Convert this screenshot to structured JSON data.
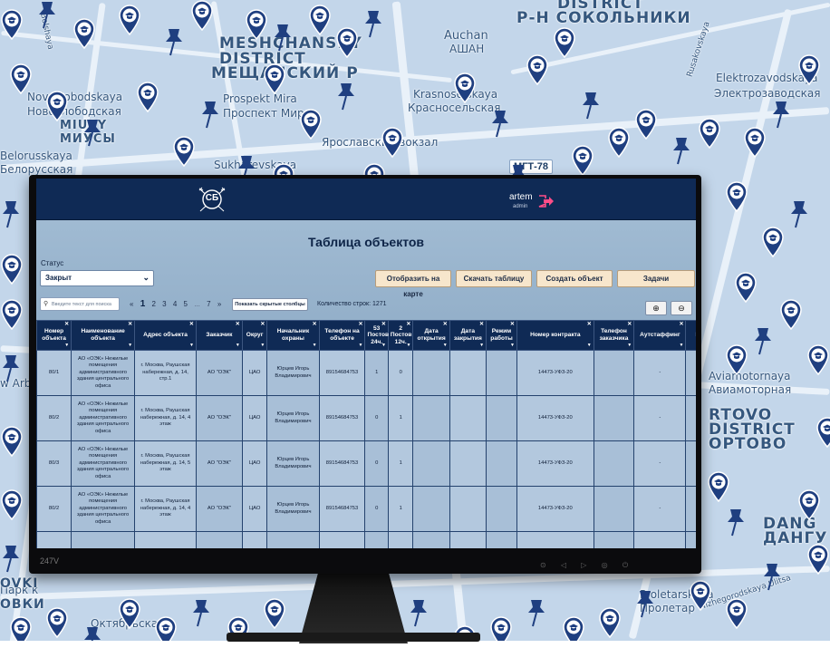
{
  "map": {
    "labels": [
      {
        "text": "DISTRICT",
        "big": true
      },
      {
        "text": "Р-Н СОКОЛЬНИКИ",
        "big": true
      },
      {
        "text": "MESHCHANSKY",
        "big": true
      },
      {
        "text": "DISTRICT",
        "big": true
      },
      {
        "text": "МЕЩАНСКИЙ Р",
        "big": true
      },
      {
        "text": "Auchan"
      },
      {
        "text": "АШАН"
      },
      {
        "text": "Novoslobodskaya"
      },
      {
        "text": "Новослободская"
      },
      {
        "text": "MIUSY",
        "big": true
      },
      {
        "text": "МИУСЫ",
        "big": true
      },
      {
        "text": "Prospekt Mira"
      },
      {
        "text": "Проспект Мира"
      },
      {
        "text": "Krasnoselskaya"
      },
      {
        "text": "Красносельская"
      },
      {
        "text": "Elektrozavodskaya"
      },
      {
        "text": "Электрозаводская"
      },
      {
        "text": "Ярославский вокзал"
      },
      {
        "text": "Sukharevskaya"
      },
      {
        "text": "Belorusskaya"
      },
      {
        "text": "Белорусская"
      },
      {
        "text": "Aviamotornaya"
      },
      {
        "text": "Авиамоторная"
      },
      {
        "text": "RTOVO",
        "big": true
      },
      {
        "text": "DISTRICT",
        "big": true
      },
      {
        "text": "ОРТОВО",
        "big": true
      },
      {
        "text": "DANG",
        "big": true
      },
      {
        "text": "ДАНГУ",
        "big": true
      },
      {
        "text": "Proletarskaya"
      },
      {
        "text": "Пролетар"
      },
      {
        "text": "Октябрьская"
      },
      {
        "text": "Парк к"
      },
      {
        "text": "OVKI",
        "big": true
      },
      {
        "text": "ОВКИ",
        "big": true
      },
      {
        "text": "w Arbat"
      },
      {
        "text": "Nizhegorodskaya Ulitsa"
      },
      {
        "text": "Rusakovskaya"
      },
      {
        "text": "Bolshaya"
      }
    ],
    "road_badges": [
      {
        "text": "МГТ-78"
      }
    ]
  },
  "monitor": {
    "model_label": "247V",
    "buttons_label": "⊙ ◁ ▷ ◎ ⏻"
  },
  "app": {
    "logo_text": "СБ",
    "user": {
      "name": "artem",
      "role": "admin"
    },
    "title": "Таблица объектов",
    "status_label": "Статус",
    "status_value": "Закрыт",
    "buttons": {
      "show_on_map": "Отобразить на карте",
      "download_table": "Скачать таблицу",
      "create_object": "Создать объект",
      "tasks": "Задачи"
    },
    "search_placeholder": "Введите текст для поиска",
    "pagination": {
      "prev": "«",
      "current": "1",
      "pages": [
        "2",
        "3",
        "4",
        "5",
        "...",
        "7"
      ],
      "next": "»"
    },
    "show_hidden_label": "Показать скрытые столбцы",
    "row_count": "Количество строк: 1271",
    "zoom_in": "⊕",
    "zoom_out": "⊖",
    "table": {
      "columns": [
        "Номер объекта",
        "Наименование объекта",
        "Адрес объекта",
        "Заказчик",
        "Округ",
        "Начальник охраны",
        "Телефон на объекте",
        "53 Постов 24ч.",
        "2 Постов 12ч.",
        "Дата открытия",
        "Дата закрытия",
        "Режим работы",
        "Номер контракта",
        "Телефон заказчика",
        "Аутстаффинг",
        "Катего"
      ],
      "rows": [
        [
          "80/1",
          "АО «ОЭК» Нежилые помещения административного здания центрального офиса",
          "г. Москва, Раушская набережная, д. 14, стр.1",
          "АО \"ОЭК\"",
          "ЦАО",
          "Юрцев Игорь Владимирович",
          "89154684753",
          "1",
          "0",
          "",
          "",
          "",
          "14473-УФЗ-20",
          "",
          "-",
          ""
        ],
        [
          "80/2",
          "АО «ОЭК» Нежилые помещения административного здания центрального офиса",
          "г. Москва, Раушская набережная, д. 14, 4 этаж",
          "АО \"ОЭК\"",
          "ЦАО",
          "Юрцев Игорь Владимирович",
          "89154684753",
          "0",
          "1",
          "",
          "",
          "",
          "14473-УФЗ-20",
          "",
          "-",
          ""
        ],
        [
          "80/3",
          "АО «ОЭК» Нежилые помещения административного здания центрального офиса",
          "г. Москва, Раушская набережная, д. 14, 5 этаж",
          "АО \"ОЭК\"",
          "ЦАО",
          "Юрцев Игорь Владимирович",
          "89154684753",
          "0",
          "1",
          "",
          "",
          "",
          "14473-УФЗ-20",
          "",
          "-",
          ""
        ],
        [
          "80/2",
          "АО «ОЭК» Нежилые помещения административного здания центрального офиса",
          "г. Москва, Раушская набережная, д. 14, 4 этаж",
          "АО \"ОЭК\"",
          "ЦАО",
          "Юрцев Игорь Владимирович",
          "89154684753",
          "0",
          "1",
          "",
          "",
          "",
          "14473-УФЗ-20",
          "",
          "-",
          ""
        ],
        [
          "",
          "АО «ОЭК» Нежилые",
          "г. Москва, Раушская",
          "",
          "",
          "",
          "",
          "",
          "",
          "",
          "",
          "",
          "",
          "",
          "",
          ""
        ]
      ]
    }
  },
  "colors": {
    "header_bg": "#0f2a55",
    "button_bg": "#f7e6cc",
    "logout_icon": "#ff4d88",
    "map_bg": "#c3d6ea",
    "pin": "#1f3f80"
  }
}
